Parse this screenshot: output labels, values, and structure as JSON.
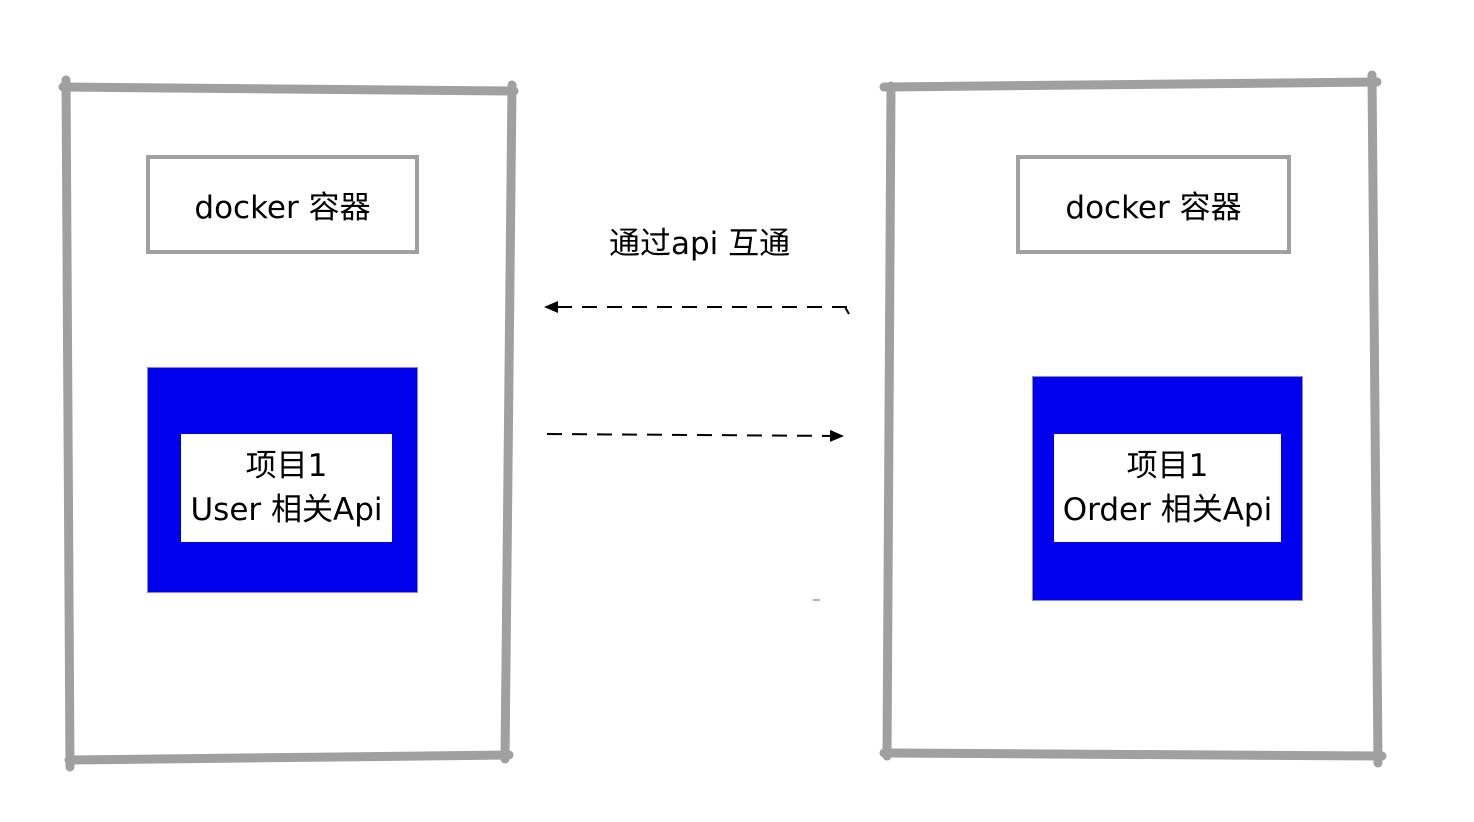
{
  "colors": {
    "container_border": "#a0a0a0",
    "project_fill": "#0000ef",
    "arrow": "#000000"
  },
  "left_container": {
    "title": "docker 容器",
    "project": {
      "line1": "项目1",
      "line2": "User 相关Api"
    }
  },
  "right_container": {
    "title": "docker 容器",
    "project": {
      "line1": "项目1",
      "line2": "Order 相关Api"
    }
  },
  "connection": {
    "label": "通过api 互通",
    "arrows": [
      "right-to-left",
      "left-to-right"
    ],
    "style": "dashed"
  }
}
